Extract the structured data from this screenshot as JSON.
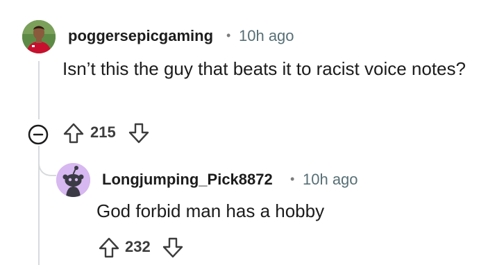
{
  "comments": [
    {
      "username": "poggersepicgaming",
      "separator": "•",
      "time": "10h ago",
      "body": "Isn’t this the guy that beats it to racist voice notes?",
      "score": "215"
    },
    {
      "username": "Longjumping_Pick8872",
      "separator": "•",
      "time": "10h ago",
      "body": "God forbid man has a hobby",
      "score": "232"
    }
  ],
  "icons": {
    "collapse": "collapse-icon",
    "upvote": "upvote-arrow-icon",
    "downvote": "downvote-arrow-icon",
    "avatar_default": "reddit-snoo-icon"
  },
  "colors": {
    "thread_line": "#d7dadc",
    "meta_text": "#576f76",
    "avatar_default_bg": "#d7b8f0"
  }
}
